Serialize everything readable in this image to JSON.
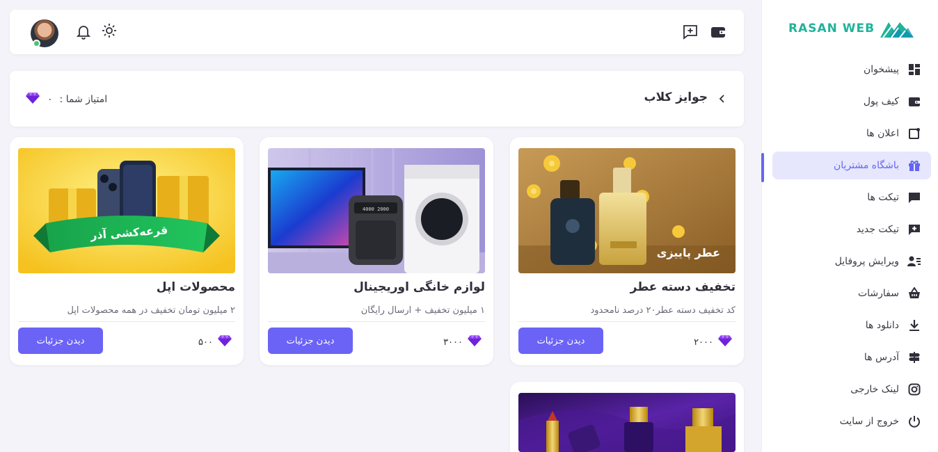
{
  "sidebar": {
    "logo": "RASAN WEB",
    "items": [
      {
        "label": "پیشخوان",
        "icon": "dashboard-icon",
        "active": false
      },
      {
        "label": "کیف پول",
        "icon": "wallet-icon",
        "active": false
      },
      {
        "label": "اعلان ها",
        "icon": "notification-icon",
        "active": false
      },
      {
        "label": "باشگاه مشتریان",
        "icon": "gift-icon",
        "active": true
      },
      {
        "label": "تیکت ها",
        "icon": "chat-icon",
        "active": false
      },
      {
        "label": "تیکت جدید",
        "icon": "chat-plus-icon",
        "active": false
      },
      {
        "label": "ویرایش پروفایل",
        "icon": "user-edit-icon",
        "active": false
      },
      {
        "label": "سفارشات",
        "icon": "basket-icon",
        "active": false
      },
      {
        "label": "دانلود ها",
        "icon": "download-icon",
        "active": false
      },
      {
        "label": "آدرس ها",
        "icon": "signpost-icon",
        "active": false
      },
      {
        "label": "لینک خارجی",
        "icon": "instagram-icon",
        "active": false
      },
      {
        "label": "خروج از سایت",
        "icon": "power-icon",
        "active": false
      }
    ]
  },
  "topbar": {
    "icons": [
      "wallet-icon",
      "chat-plus-icon",
      "sun-icon",
      "bell-icon"
    ]
  },
  "header": {
    "title": "جوایز کلاب",
    "score_label": "امتیاز شما :",
    "score_value": "۰"
  },
  "cards": [
    {
      "title": "تخفیف دسته عطر",
      "desc": "کد تخفیف دسته عطر۲۰ درصد نامحدود",
      "points": "۲۰۰۰",
      "button": "دیدن جزئیات",
      "image_caption": "عطر پاییزی"
    },
    {
      "title": "لوازم خانگی اوریجینال",
      "desc": "۱ میلیون تخفیف + ارسال رایگان",
      "points": "۳۰۰۰",
      "button": "دیدن جزئیات",
      "image_caption": "4000 2000"
    },
    {
      "title": "محصولات اپل",
      "desc": "۲ میلیون تومان تخفیف در همه محصولات اپل",
      "points": "۵۰۰",
      "button": "دیدن جزئیات",
      "image_caption": "قرعه‌کشی آذر"
    }
  ],
  "colors": {
    "accent": "#6b63f6",
    "brand": "#20b39a",
    "background": "#f3f3f9",
    "active_bg": "#e6e6fd",
    "gem": "#8a3df0"
  }
}
